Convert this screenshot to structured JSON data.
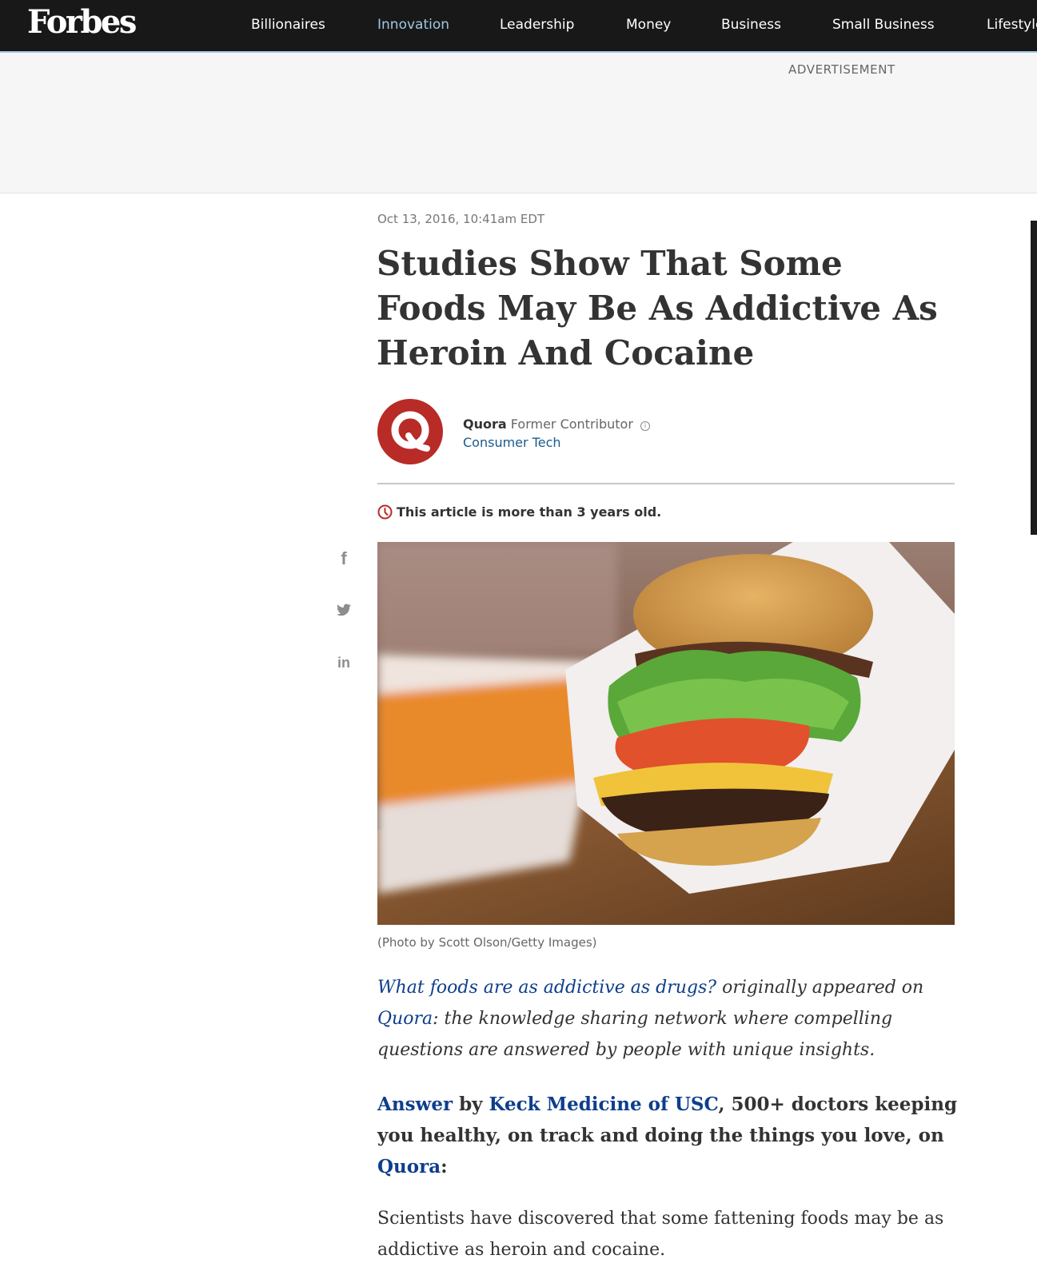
{
  "nav": {
    "logo": "Forbes",
    "items": [
      "Billionaires",
      "Innovation",
      "Leadership",
      "Money",
      "Business",
      "Small Business",
      "Lifestyle"
    ],
    "active_index": 1,
    "background_color": "#181818",
    "active_color": "#9fc8e0"
  },
  "ad": {
    "label": "ADVERTISEMENT"
  },
  "article": {
    "date": "Oct 13, 2016, 10:41am EDT",
    "headline_lines": [
      "Studies Show That Some",
      "Foods May Be As Addictive As",
      "Heroin And Cocaine"
    ],
    "author": {
      "avatar_letter": "Q",
      "avatar_color": "#b92b27",
      "name": "Quora",
      "role": "Former Contributor",
      "role_info_icon": "info-icon",
      "channel": "Consumer Tech"
    },
    "age_notice": "This article is more than 3 years old.",
    "age_notice_icon": "clock-icon",
    "share_icons": [
      "facebook-icon",
      "twitter-icon",
      "linkedin-icon"
    ],
    "image_caption": "(Photo by Scott Olson/Getty Images)",
    "intro": {
      "link1": "What foods are as addictive as drugs?",
      "text1": " originally appeared on ",
      "link2": "Quora",
      "text2": ": the knowledge sharing network where compelling questions are answered by people with unique insights."
    },
    "answer": {
      "link1": "Answer",
      "text1": " by ",
      "link2": "Keck Medicine of USC",
      "text2": ", 500+ doctors keeping you healthy, on track and doing the things you love, on ",
      "link3": "Quora",
      "text3": ":"
    },
    "body_paragraph": "Scientists have discovered that some fattening foods may be as addictive as heroin and cocaine.",
    "link_color": "#0e3e8c"
  }
}
